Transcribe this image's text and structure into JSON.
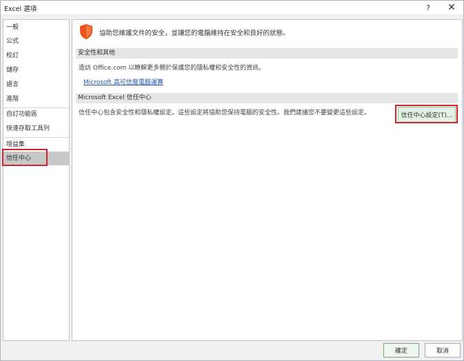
{
  "window": {
    "title": "Excel 選項",
    "help_glyph": "?",
    "close_glyph": "✕"
  },
  "sidebar": {
    "items": [
      {
        "label": "一般"
      },
      {
        "label": "公式"
      },
      {
        "label": "校訂"
      },
      {
        "label": "儲存"
      },
      {
        "label": "語言"
      },
      {
        "label": "進階"
      },
      {
        "label": "自訂功能區"
      },
      {
        "label": "快速存取工具列"
      },
      {
        "label": "增益集"
      },
      {
        "label": "信任中心",
        "selected": true
      }
    ]
  },
  "content": {
    "intro_icon": "shield-icon",
    "intro": "協助您維護文件的安全，並讓您的電腦維持在安全和良好的狀態。",
    "security_section": {
      "header": "安全性和其他",
      "text": "造訪 Office.com 以瞭解更多關於保護您的隱私權和安全性的資訊。",
      "link": "Microsoft 高可信度電腦運算"
    },
    "trust_center_section": {
      "header": "Microsoft Excel 信任中心",
      "text": "信任中心包含安全性和隱私權設定。這些設定將協助您保持電腦的安全性。我們建議您不要變更這些設定。",
      "button": "信任中心設定(T)..."
    }
  },
  "footer": {
    "ok": "確定",
    "cancel": "取消"
  },
  "colors": {
    "highlight": "#d0232a",
    "shield": "#e8541c",
    "link": "#2255a4",
    "selected_nav": "#c8c8c8"
  }
}
